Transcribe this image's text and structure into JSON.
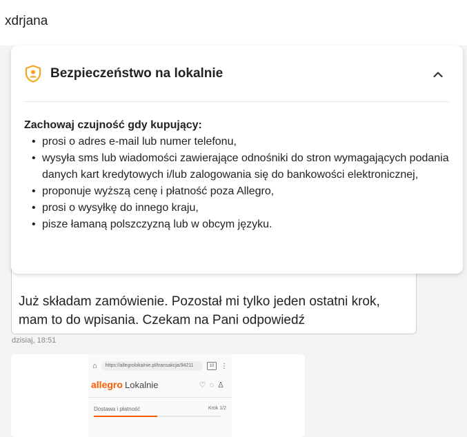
{
  "header": {
    "username": "xdrjana"
  },
  "safety_panel": {
    "title": "Bezpieczeństwo na lokalnie",
    "heading": "Zachowaj czujność gdy kupujący:",
    "items": [
      "prosi o adres e-mail lub numer telefonu,",
      "wysyła sms lub wiadomości zawierające odnośniki do stron wymagających podania danych kart kredytowych i/lub zalogowania się do bankowości elektronicznej,",
      "proponuje wyższą cenę i płatność poza Allegro,",
      "prosi o wysyłkę do innego kraju,",
      "pisze łamaną polszczyzną lub w obcym języku."
    ],
    "accent_color": "#f5a623",
    "icons": {
      "badge": "shield-user-icon",
      "toggle": "chevron-up-icon"
    }
  },
  "message": {
    "text": "Już składam zamówienie. Pozostał mi tylko jeden ostatni krok, mam to do wpisania. Czekam na Pani odpowiedź",
    "time": "dzisiaj, 18:51"
  },
  "attachment": {
    "url": "https://allegrolokalnie.pl/transakcja/94211",
    "tabs_count": "10",
    "brand": "allegro",
    "brand_sub": "Lokalnie",
    "step_label": "Dostawa i płatność",
    "step_count": "Krok 1/2",
    "progress_fraction": 0.5,
    "brand_color": "#ff5a00"
  }
}
